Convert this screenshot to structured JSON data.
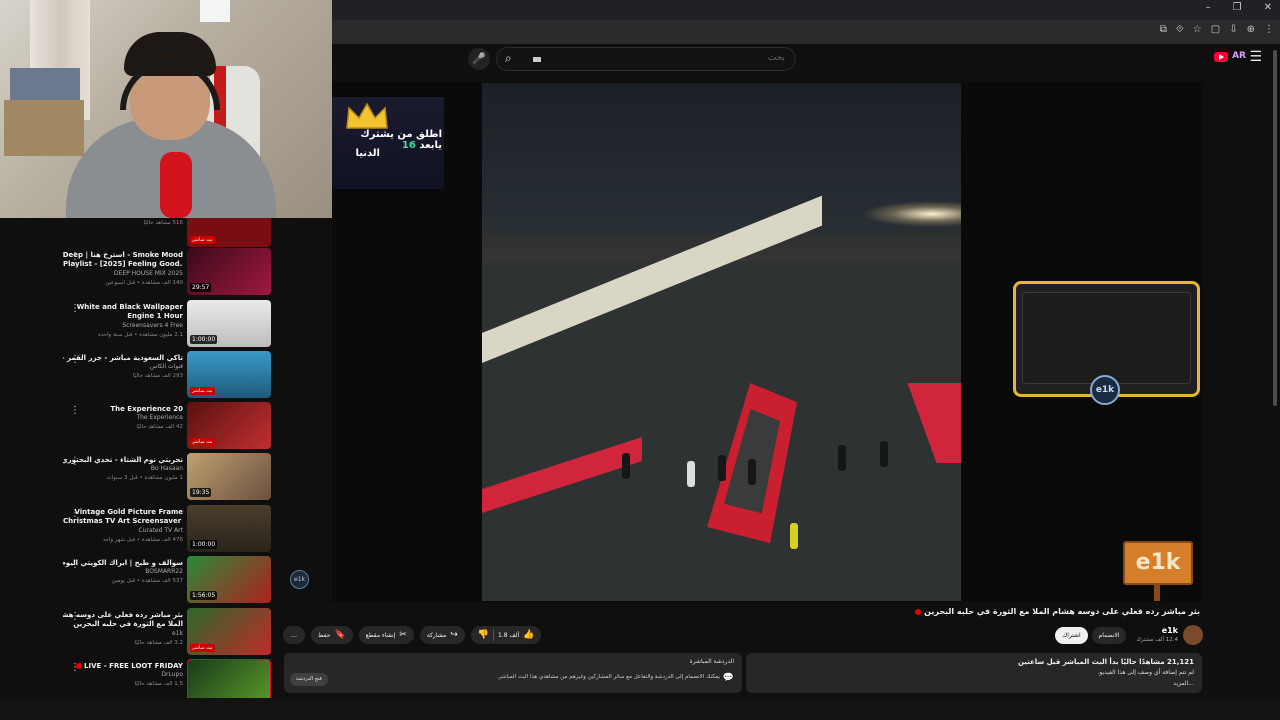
{
  "browser": {
    "window_controls": [
      "–",
      "❐",
      "✕"
    ],
    "toolbar_icons": [
      "⧉",
      "⟐",
      "☆",
      "▢",
      "⇩",
      "⊕",
      "⋮"
    ]
  },
  "header": {
    "search_placeholder": "بحث",
    "menu_icon": "☰",
    "logo_text": "AR"
  },
  "overlay": {
    "sub_line1_a": "اطلق من يشترك يابعد",
    "sub_line1_num": "16",
    "sub_line2": "الدنيا",
    "frame_logo": "e1k",
    "sign_text": "e1k"
  },
  "sidebar": {
    "items": [
      {
        "title": "",
        "title2": "",
        "channel": "",
        "meta": "516 مشاهد حاليًا",
        "badge": "بث مباشر",
        "thumb": "#7a0d12"
      },
      {
        "title": "Smoke Mood - استرخ هنا | Deep",
        "title2": "Playlist - [2025] Feeling Good...",
        "channel": "DEEP HOUSE MIX 2025",
        "meta": "140 ألف مشاهدة • قبل أسبوعين",
        "duration": "29:57",
        "thumb": "#5a1020"
      },
      {
        "title": "White and Black Wallpaper",
        "title2": "Engine 1 Hour",
        "channel": "Screensavers 4 Free",
        "meta": "2.1 مليون مشاهدة • قبل سنة واحدة",
        "duration": "1:00:00",
        "thumb": "#d8d8d8"
      },
      {
        "title": "تاكي السعودية مباشر - جزر القمر - السعودية",
        "title2": "",
        "channel": "قنوات الكاس",
        "meta": "293 ألف مشاهد حاليًا",
        "badge": "بث مباشر",
        "thumb": "#2f7fa6"
      },
      {
        "title": "The Experience 20",
        "title2": "",
        "channel": "The Experience",
        "meta": "42 ألف مشاهد حاليًا",
        "badge": "بث مباشر",
        "thumb": "#7a1a1a"
      },
      {
        "title": "تجربتي نوم الشتاء - تحدي البحتوري",
        "title2": "",
        "channel": "Bo Hasaan",
        "meta": "1 مليون مشاهدة • قبل 3 سنوات",
        "duration": "19:35",
        "thumb": "#a08a6a"
      },
      {
        "title": "Vintage Gold Picture Frame",
        "title2": "Christmas TV Art Screensaver |...",
        "channel": "Curated TV Art",
        "meta": "476 ألف مشاهدة • قبل شهر واحد",
        "duration": "1:00:00",
        "thumb": "#3a3428"
      },
      {
        "title": "سوالف و طبخ | ابراك الكويتي اليوم",
        "title2": "",
        "channel": "BOSMARR22",
        "meta": "537 ألف مشاهدة • قبل يومين",
        "duration": "1:56:05",
        "thumb": "#2a7a3a"
      },
      {
        "title": "بثر مباشر رده فعلي على دوسه هشام",
        "title2": "الملا مع الثورة في حلبه البحرين",
        "channel": "e1k",
        "meta": "3.2 ألف مشاهد حاليًا",
        "badge": "بث مباشر",
        "thumb": "#2a4a2a"
      },
      {
        "title": "LIVE - FREE LOOT FRIDAY",
        "title2": "",
        "channel": "DrLupo",
        "meta": "1.5 ألف مشاهد حاليًا",
        "badge": "بث مباشر",
        "thumb": "#1a4a1a"
      }
    ]
  },
  "video": {
    "title": "بثر مباشر رده فعلي على دوسه هشام الملا مع الثورة في حلبه البحرين",
    "channel_name": "e1k",
    "channel_subs": "12.4 ألف مشترك",
    "join_label": "الانضمام",
    "subscribe_label": "اشتراك",
    "like_count": "1.8 ألف",
    "share_label": "مشاركة",
    "clip_label": "إنشاء مقطع",
    "save_label": "حفظ",
    "more_label": "…"
  },
  "description": {
    "views": "21,121 مشاهدًا حاليًا  بدأ البث المباشر قبل ساعتين",
    "line": "لم تتم إضافة أي وصف إلى هذا الفيديو.",
    "more": "...المزيد"
  },
  "chat": {
    "title": "الدردشة المباشرة",
    "desc": "يمكنك الانضمام إلى الدردشة والتفاعل مع سائر المشاركين وغيرهم من مشاهدي هذا البث المباشر.",
    "button": "فتح الدردشة"
  },
  "colors": {
    "accent_red": "#ff0033",
    "frame_gold": "#e7b53a",
    "highlight_green": "#3de0a0"
  }
}
